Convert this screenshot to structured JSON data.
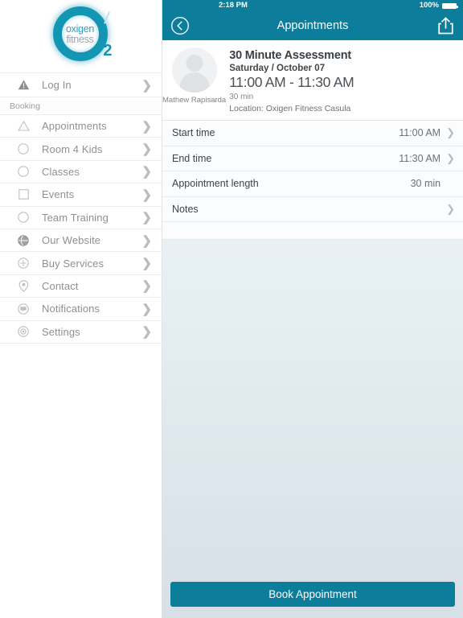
{
  "theme": {
    "teal": "#0d7d9c",
    "logo_teal": "#1395b4",
    "text_grey": "#8c9196"
  },
  "sidebar": {
    "logo": {
      "line1": "oxigen",
      "line2": "fitness",
      "subscript": "2",
      "icon": "oxigen-logo-ring"
    },
    "login": {
      "label": "Log In",
      "icon": "warning-triangle-icon",
      "chevron": "❯"
    },
    "section_label": "Booking",
    "items": [
      {
        "label": "Appointments",
        "icon": "triangle-icon",
        "chevron": "❯"
      },
      {
        "label": "Room 4 Kids",
        "icon": "circle-icon",
        "chevron": "❯"
      },
      {
        "label": "Classes",
        "icon": "circle-icon",
        "chevron": "❯"
      },
      {
        "label": "Events",
        "icon": "square-icon",
        "chevron": "❯"
      },
      {
        "label": "Team Training",
        "icon": "circle-icon",
        "chevron": "❯"
      },
      {
        "label": "Our Website",
        "icon": "globe-icon",
        "chevron": "❯"
      },
      {
        "label": "Buy Services",
        "icon": "plus-circle-icon",
        "chevron": "❯"
      },
      {
        "label": "Contact",
        "icon": "location-pin-icon",
        "chevron": "❯"
      },
      {
        "label": "Notifications",
        "icon": "speech-bubble-icon",
        "chevron": "❯"
      },
      {
        "label": "Settings",
        "icon": "gear-icon",
        "chevron": "❯"
      }
    ]
  },
  "statusbar": {
    "time": "2:18 PM",
    "battery_percent": "100%",
    "battery_icon": "battery-full-icon"
  },
  "navbar": {
    "title": "Appointments",
    "back_icon": "back-chevron-circle-icon",
    "share_icon": "share-icon"
  },
  "appointment": {
    "client_name": "Mathew Rapisarda",
    "avatar_icon": "avatar-placeholder-icon",
    "title": "30 Minute Assessment",
    "date": "Saturday / October 07",
    "time_range": "11:00 AM - 11:30 AM",
    "duration": "30 min",
    "location": "Location: Oxigen Fitness Casula"
  },
  "detail_rows": [
    {
      "label": "Start time",
      "value": "11:00 AM",
      "chevron": "❯",
      "has_chevron": true
    },
    {
      "label": "End time",
      "value": "11:30 AM",
      "chevron": "❯",
      "has_chevron": true
    },
    {
      "label": "Appointment length",
      "value": "30 min",
      "chevron": "❯",
      "has_chevron": false
    },
    {
      "label": "Notes",
      "value": "",
      "chevron": "❯",
      "has_chevron": true
    }
  ],
  "footer": {
    "book_label": "Book Appointment"
  }
}
